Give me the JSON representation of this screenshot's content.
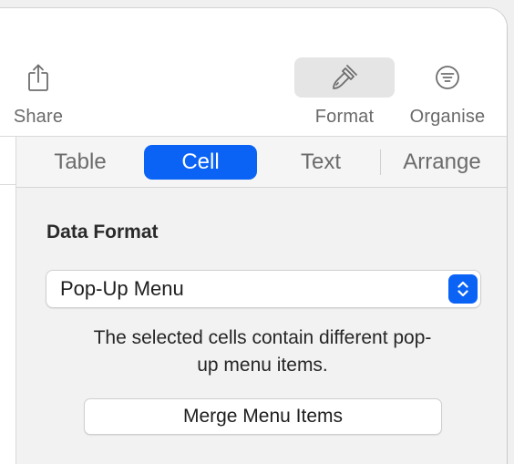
{
  "toolbar": {
    "share": {
      "label": "Share",
      "icon": "share-icon"
    },
    "format": {
      "label": "Format",
      "icon": "paintbrush-icon",
      "active": true
    },
    "organise": {
      "label": "Organise",
      "icon": "organise-filter-icon"
    }
  },
  "tabs": [
    {
      "label": "Table",
      "selected": false
    },
    {
      "label": "Cell",
      "selected": true
    },
    {
      "label": "Text",
      "selected": false
    },
    {
      "label": "Arrange",
      "selected": false
    }
  ],
  "data_format": {
    "title": "Data Format",
    "selected_value": "Pop-Up Menu",
    "stepper_icon": "up-down-chevron-icon"
  },
  "message": {
    "line1": "The selected cells contain different pop-",
    "line2": "up menu items."
  },
  "merge_button": {
    "label": "Merge Menu Items"
  },
  "colors": {
    "accent": "#0a63f5",
    "inspector_bg": "#f2f2f2",
    "toolbar_active_bg": "#e5e5e5",
    "label_gray": "#6a6a6a"
  }
}
